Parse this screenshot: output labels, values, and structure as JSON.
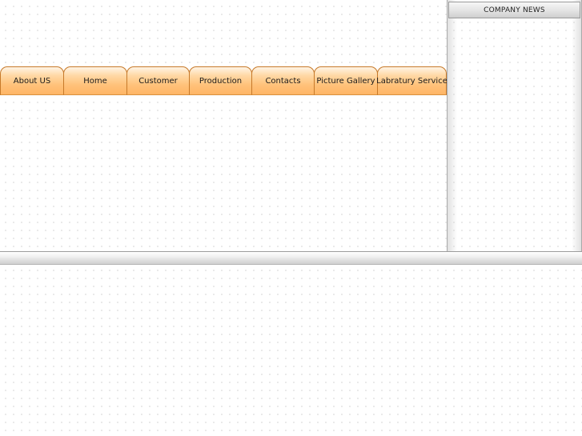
{
  "nav": {
    "tabs": [
      {
        "label": "About US"
      },
      {
        "label": "Home"
      },
      {
        "label": "Customer"
      },
      {
        "label": "Production"
      },
      {
        "label": "Contacts"
      },
      {
        "label": "Picture Gallery"
      },
      {
        "label": "Labratury Service"
      }
    ]
  },
  "news": {
    "title": "COMPANY NEWS"
  },
  "colors": {
    "tab_fill": "#ffc27a",
    "tab_border": "#c77a2a",
    "panel_border": "#a9a9a9",
    "background": "#ffffff"
  }
}
